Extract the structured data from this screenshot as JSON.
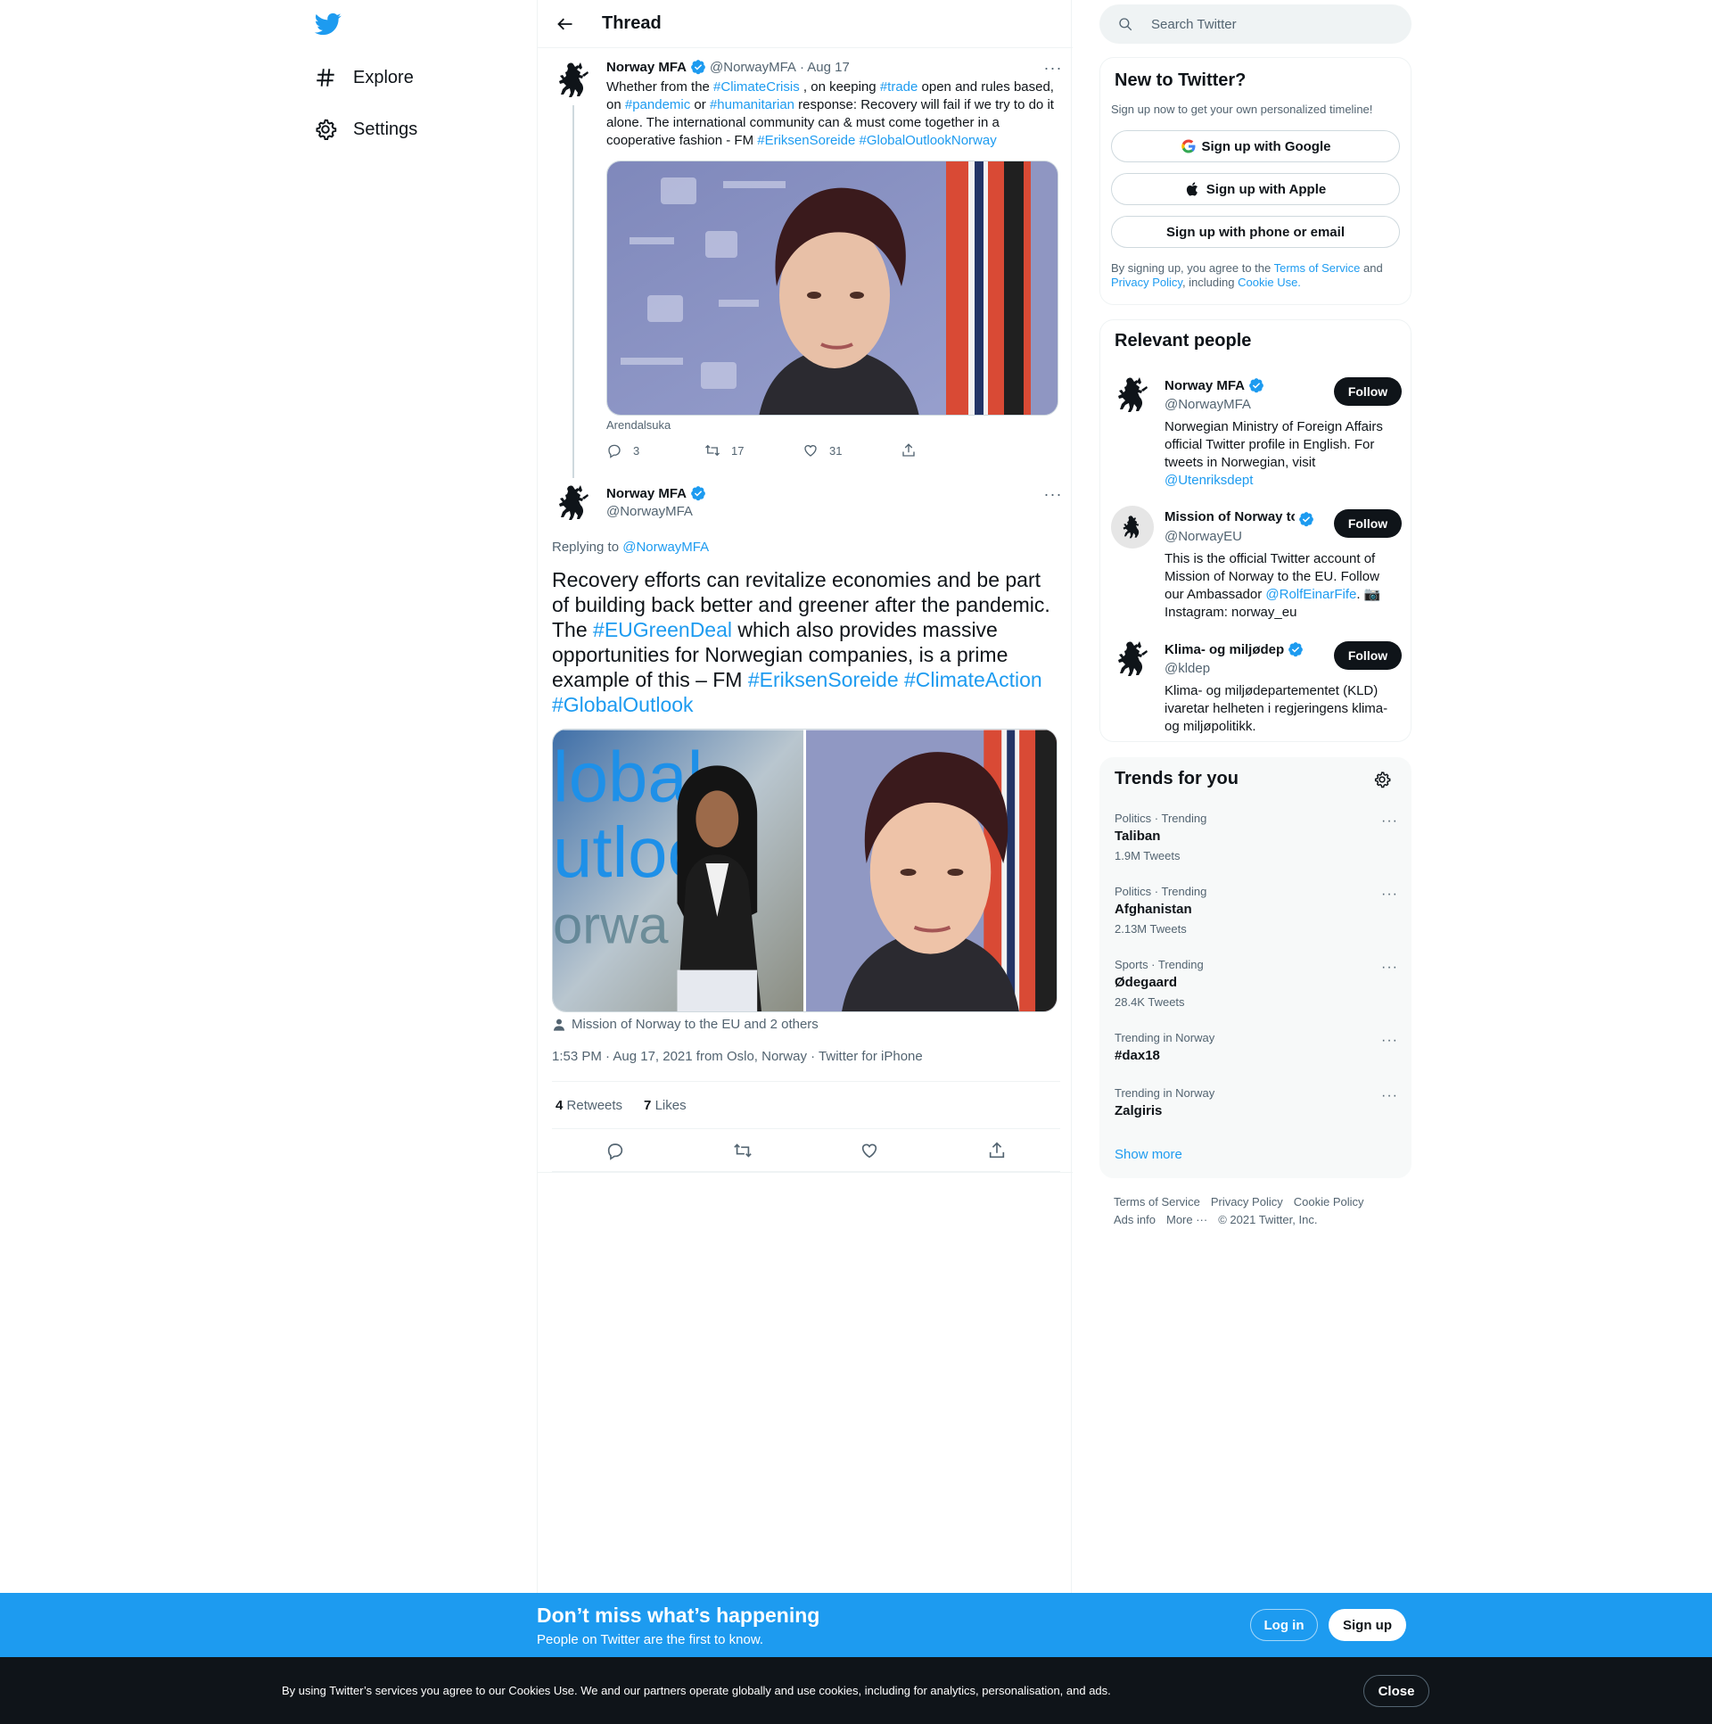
{
  "nav": {
    "logo": "twitter-bird-icon",
    "items": [
      {
        "label": "Explore",
        "icon": "hashtag-icon"
      },
      {
        "label": "Settings",
        "icon": "gear-icon"
      }
    ]
  },
  "header": {
    "title": "Thread"
  },
  "tweet1": {
    "name": "Norway MFA",
    "handle": "@NorwayMFA",
    "date": "· Aug 17",
    "text_parts": [
      "Whether from the ",
      "#ClimateCrisis",
      " , on keeping ",
      "#trade",
      " open and rules based, on ",
      "#pandemic",
      " or ",
      "#humanitarian",
      " response: Recovery will fail if we try to do it alone. The international community can  & must come together in a cooperative fashion - FM ",
      "#EriksenSoreide",
      " ",
      "#GlobalOutlookNorway"
    ],
    "media_caption": "Arendalsuka",
    "replies": "3",
    "retweets": "17",
    "likes": "31"
  },
  "tweet2": {
    "name": "Norway MFA",
    "handle": "@NorwayMFA",
    "replying_prefix": "Replying to ",
    "replying_to": "@NorwayMFA",
    "text_parts": [
      "Recovery efforts can revitalize economies and be part of building back better and greener after the pandemic. The ",
      "#EUGreenDeal",
      " which also provides massive opportunities for Norwegian companies, is a prime example of this – FM ",
      "#EriksenSoreide",
      " ",
      "#ClimateAction",
      " ",
      "#GlobalOutlook"
    ],
    "tagged": "Mission of Norway to the EU and 2 others",
    "timestamp": "1:53 PM · Aug 17, 2021 from Oslo, Norway · Twitter for iPhone",
    "retweets_count": "4",
    "retweets_label": "Retweets",
    "likes_count": "7",
    "likes_label": "Likes"
  },
  "search": {
    "placeholder": "Search Twitter"
  },
  "new_to_twitter": {
    "title": "New to Twitter?",
    "subtitle": "Sign up now to get your own personalized timeline!",
    "google": "Sign up with Google",
    "apple": "Sign up with Apple",
    "phone": "Sign up with phone or email",
    "legal_1": "By signing up, you agree to the ",
    "terms": "Terms of Service",
    "legal_2": " and ",
    "privacy": "Privacy Policy",
    "legal_3": ", including ",
    "cookie": "Cookie Use."
  },
  "relevant_people": {
    "title": "Relevant people",
    "follow_label": "Follow",
    "people": [
      {
        "name": "Norway MFA",
        "handle": "@NorwayMFA",
        "bio_1": "Norwegian Ministry of Foreign Affairs official Twitter profile in English. For tweets in Norwegian, visit ",
        "bio_link": "@Utenriksdept",
        "bio_2": ""
      },
      {
        "name": "Mission of Norway to the EU",
        "handle": "@NorwayEU",
        "bio_1": "This is the official Twitter account of Mission of Norway to the EU. Follow our Ambassador ",
        "bio_link": "@RolfEinarFife",
        "bio_2": ". 📷 Instagram: norway_eu"
      },
      {
        "name": "Klima- og miljødep",
        "handle": "@kldep",
        "bio_1": "Klima- og miljødepartementet (KLD) ivaretar helheten i regjeringens klima- og miljøpolitikk.",
        "bio_link": "",
        "bio_2": ""
      }
    ]
  },
  "trends": {
    "title": "Trends for you",
    "items": [
      {
        "meta": "Politics · Trending",
        "name": "Taliban",
        "count": "1.9M Tweets"
      },
      {
        "meta": "Politics · Trending",
        "name": "Afghanistan",
        "count": "2.13M Tweets"
      },
      {
        "meta": "Sports · Trending",
        "name": "Ødegaard",
        "count": "28.4K Tweets"
      },
      {
        "meta": "Trending in Norway",
        "name": "#dax18",
        "count": ""
      },
      {
        "meta": "Trending in Norway",
        "name": "Zalgiris",
        "count": ""
      }
    ],
    "show_more": "Show more"
  },
  "footer": {
    "links": [
      "Terms of Service",
      "Privacy Policy",
      "Cookie Policy",
      "Ads info",
      "More ···",
      "© 2021 Twitter, Inc."
    ]
  },
  "banner": {
    "title": "Don’t miss what’s happening",
    "subtitle": "People on Twitter are the first to know.",
    "login": "Log in",
    "signup": "Sign up"
  },
  "cookie_bar": {
    "text": "By using Twitter’s services you agree to our Cookies Use. We and our partners operate globally and use cookies, including for analytics, personalisation, and ads.",
    "close": "Close"
  },
  "colors": {
    "accent": "#1d9bf0",
    "text": "#0f1419",
    "muted": "#536471",
    "cookie_bg": "#0f1419"
  }
}
